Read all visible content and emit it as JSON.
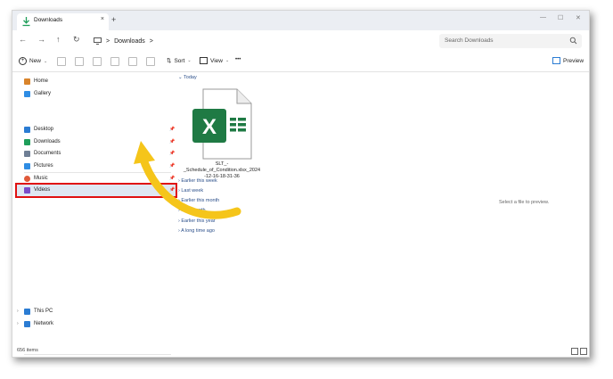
{
  "tab": {
    "label": "Downloads",
    "close": "×",
    "new_tab": "+"
  },
  "window_controls": {
    "minimize": "—",
    "maximize": "☐",
    "close": "✕"
  },
  "nav": {
    "back": "←",
    "forward": "→",
    "up": "↑",
    "refresh": "↻"
  },
  "address": {
    "separator": ">",
    "folder": "Downloads",
    "trailing": ">"
  },
  "search": {
    "placeholder": "Search Downloads"
  },
  "commands": {
    "new": "New",
    "sort": "Sort",
    "view": "View",
    "more": "•••",
    "preview": "Preview"
  },
  "sidebar": {
    "top": [
      {
        "label": "Home",
        "icon": "home-icon",
        "color": "#d9842b"
      },
      {
        "label": "Gallery",
        "icon": "gallery-icon",
        "color": "#2f8de4"
      }
    ],
    "quick": [
      {
        "label": "Desktop",
        "icon": "desktop-icon",
        "color": "#2b7cd3"
      },
      {
        "label": "Downloads",
        "icon": "downloads-icon",
        "color": "#1e9e5a"
      },
      {
        "label": "Documents",
        "icon": "documents-icon",
        "color": "#6f7f95"
      },
      {
        "label": "Pictures",
        "icon": "pictures-icon",
        "color": "#2f8de4"
      },
      {
        "label": "Music",
        "icon": "music-icon",
        "color": "#e05a3a"
      },
      {
        "label": "Videos",
        "icon": "videos-icon",
        "color": "#7a4cc9"
      }
    ],
    "bottom": [
      {
        "label": "This PC",
        "icon": "this-pc-icon",
        "color": "#2b7cd3"
      },
      {
        "label": "Network",
        "icon": "network-icon",
        "color": "#2b7cd3"
      }
    ]
  },
  "content": {
    "today": "Today",
    "file_name_line1": "SLT_-_Schedule_of_Condition.xlsx_2024",
    "file_name_line2": "-12-16-18-31-36",
    "file_icon_letter": "X",
    "groups": [
      "Earlier this week",
      "Last week",
      "Earlier this month",
      "Last month",
      "Earlier this year",
      "A long time ago"
    ]
  },
  "preview_pane": {
    "message": "Select a file to preview."
  },
  "status": {
    "items": "656 items"
  },
  "colors": {
    "excel_green": "#1f7a44",
    "highlight_red": "#e01010",
    "arrow_yellow": "#f5c51a",
    "link_blue": "#2b4f8a"
  }
}
